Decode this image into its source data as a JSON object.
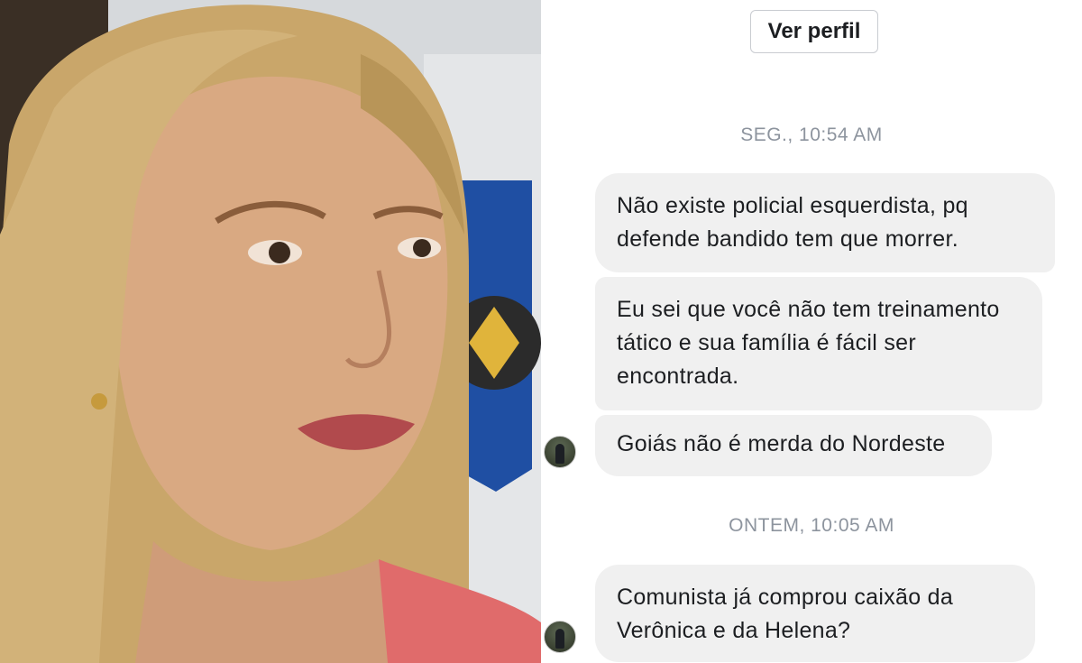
{
  "chat": {
    "profile_button_label": "Ver perfil",
    "timestamps": [
      "SEG., 10:54 AM",
      "ONTEM, 10:05 AM"
    ],
    "messages": [
      "Não existe policial esquerdista, pq defende bandido tem que morrer.",
      "Eu sei que você não tem treinamento tático e sua família é fácil ser encontrada.",
      "Goiás não é merda do Nordeste",
      "Comunista já comprou caixão da Verônica e da Helena?"
    ]
  },
  "colors": {
    "bubble_bg": "#f0f0f0",
    "timestamp_text": "#8d949e",
    "message_text": "#1c1e21"
  }
}
